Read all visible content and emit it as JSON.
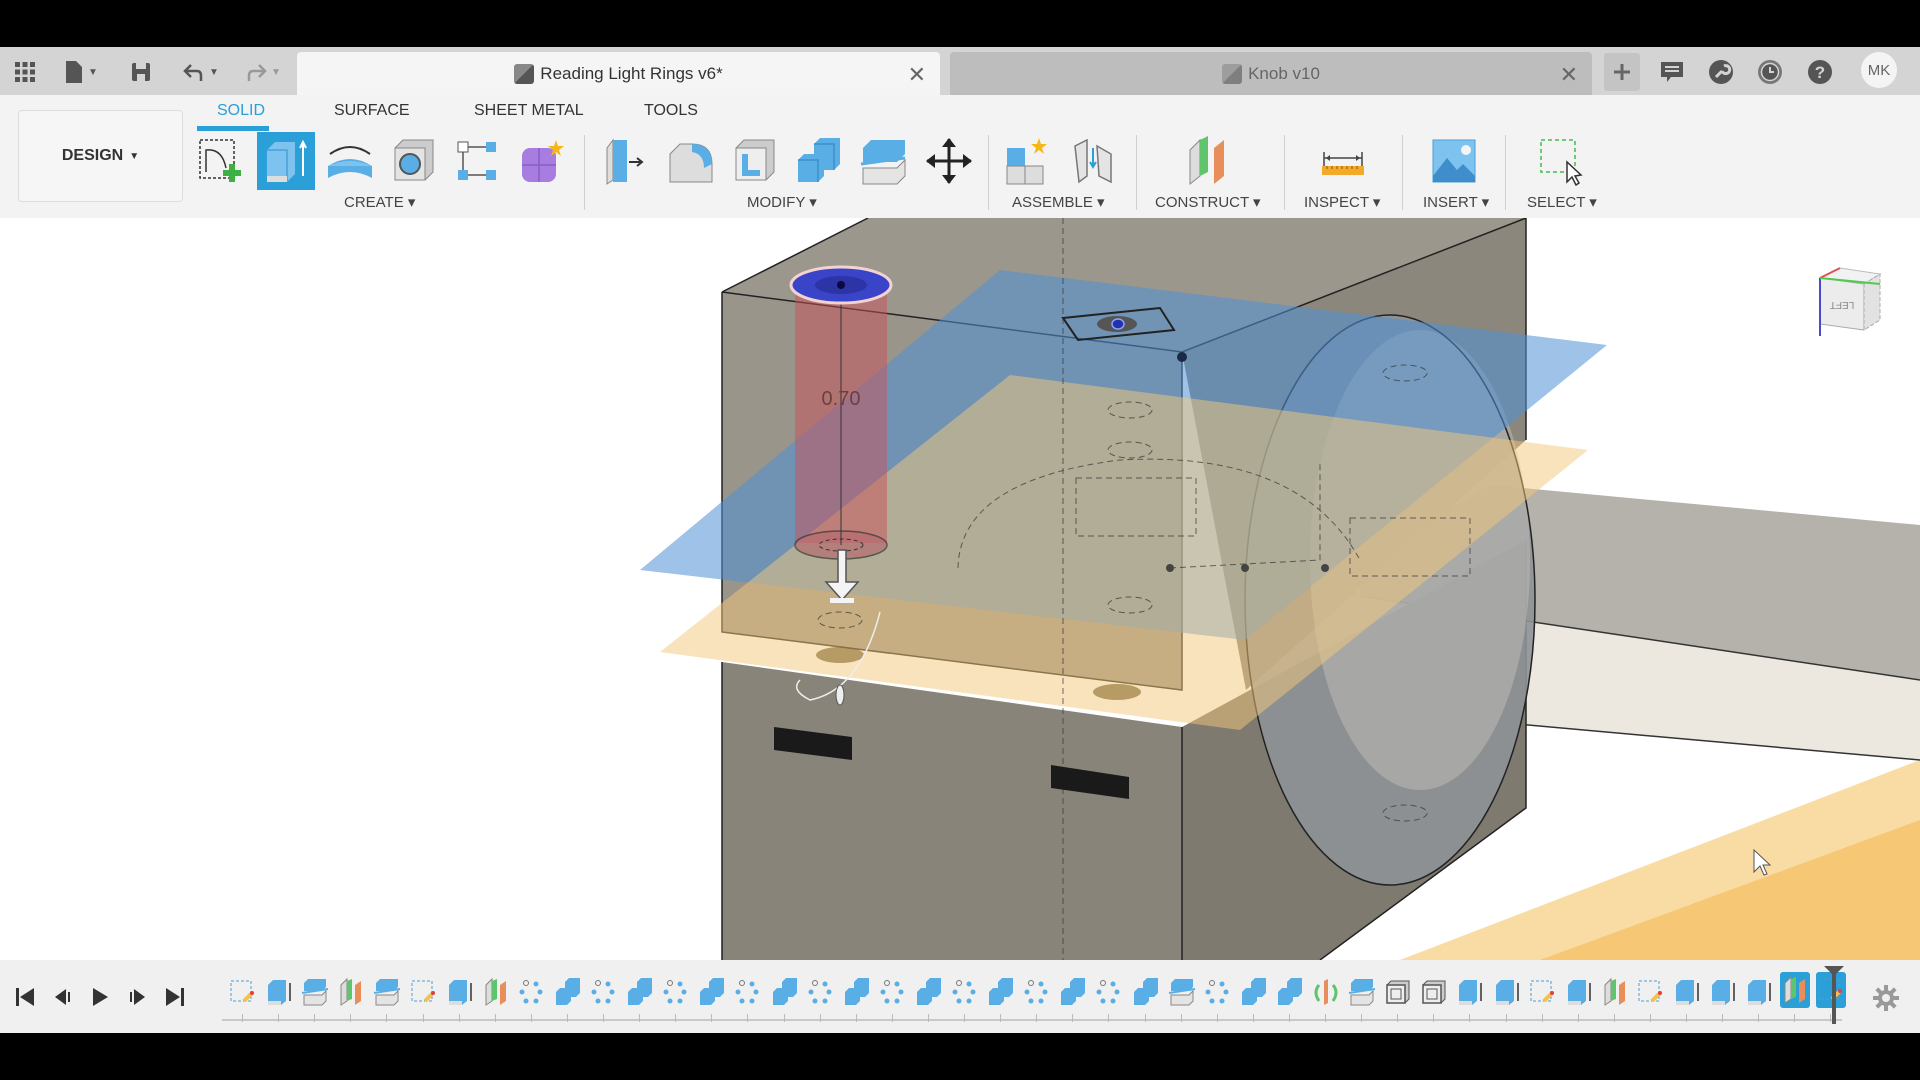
{
  "app": {
    "tabs": [
      {
        "label": "Reading Light Rings v6*",
        "active": true
      },
      {
        "label": "Knob v10",
        "active": false
      }
    ],
    "quick_access": [
      "apps-grid-icon",
      "file-icon",
      "save-icon",
      "undo-icon",
      "redo-icon"
    ],
    "right_icons": [
      "new-tab-icon",
      "comments-icon",
      "extensions-icon",
      "job-status-icon",
      "help-icon"
    ],
    "user_initials": "MK"
  },
  "toolbar": {
    "workspace": "DESIGN",
    "workspace_tabs": [
      "SOLID",
      "SURFACE",
      "SHEET METAL",
      "TOOLS"
    ],
    "active_workspace_tab": "SOLID",
    "groups": {
      "create": "CREATE",
      "modify": "MODIFY",
      "assemble": "ASSEMBLE",
      "construct": "CONSTRUCT",
      "inspect": "INSPECT",
      "insert": "INSERT",
      "select": "SELECT"
    }
  },
  "viewport": {
    "dimension_value": "0.70",
    "viewcube_face": "LEFT",
    "colors": {
      "body": "#8a857b",
      "blue_plane": "#4f8fd6",
      "orange_plane": "#f3c77a",
      "extrude_preview": "#c9525a"
    }
  },
  "timeline": {
    "controls": [
      "skip-to-start",
      "step-back",
      "play",
      "step-forward",
      "skip-to-end"
    ],
    "features": [
      "sketch",
      "extrude",
      "offset-plane-split",
      "construct-plane",
      "offset-plane-split",
      "sketch",
      "extrude",
      "construct-plane",
      "pattern",
      "combine",
      "pattern",
      "combine",
      "pattern",
      "combine",
      "pattern",
      "combine",
      "pattern",
      "combine",
      "pattern",
      "combine",
      "pattern",
      "combine",
      "pattern",
      "combine",
      "pattern",
      "combine",
      "split",
      "pattern",
      "combine",
      "combine",
      "mirror-plane",
      "split",
      "shell",
      "shell",
      "extrude",
      "extrude",
      "sketch",
      "extrude",
      "construct-plane",
      "sketch",
      "extrude",
      "extrude",
      "extrude",
      "construct-plane",
      "sketch"
    ]
  },
  "accent_color": "#2a9fd8"
}
